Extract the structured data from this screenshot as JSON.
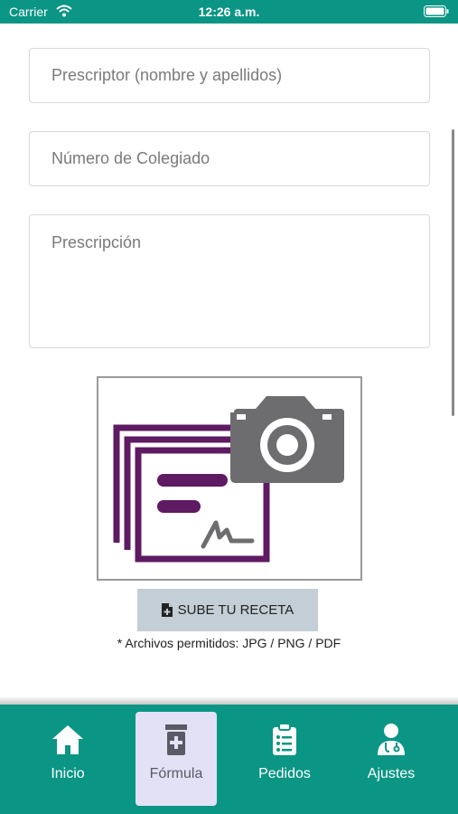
{
  "status_bar": {
    "carrier": "Carrier",
    "time": "12:26 a.m."
  },
  "form": {
    "prescriber_placeholder": "Prescriptor (nombre y apellidos)",
    "license_placeholder": "Número de Colegiado",
    "prescription_placeholder": "Prescripción"
  },
  "upload": {
    "button_label": "SUBE TU RECETA",
    "note": "* Archivos permitidos: JPG / PNG / PDF"
  },
  "nav": {
    "items": [
      {
        "label": "Inicio",
        "icon": "home-icon"
      },
      {
        "label": "Fórmula",
        "icon": "medicine-bottle-icon"
      },
      {
        "label": "Pedidos",
        "icon": "clipboard-list-icon"
      },
      {
        "label": "Ajustes",
        "icon": "doctor-icon"
      }
    ],
    "active_index": 1
  },
  "colors": {
    "brand_teal": "#0b9584",
    "button_gray": "#c3ced6",
    "illustration_purple": "#5e1a62",
    "camera_gray": "#6d6d6f",
    "active_tab_bg": "#e2e1f5"
  }
}
